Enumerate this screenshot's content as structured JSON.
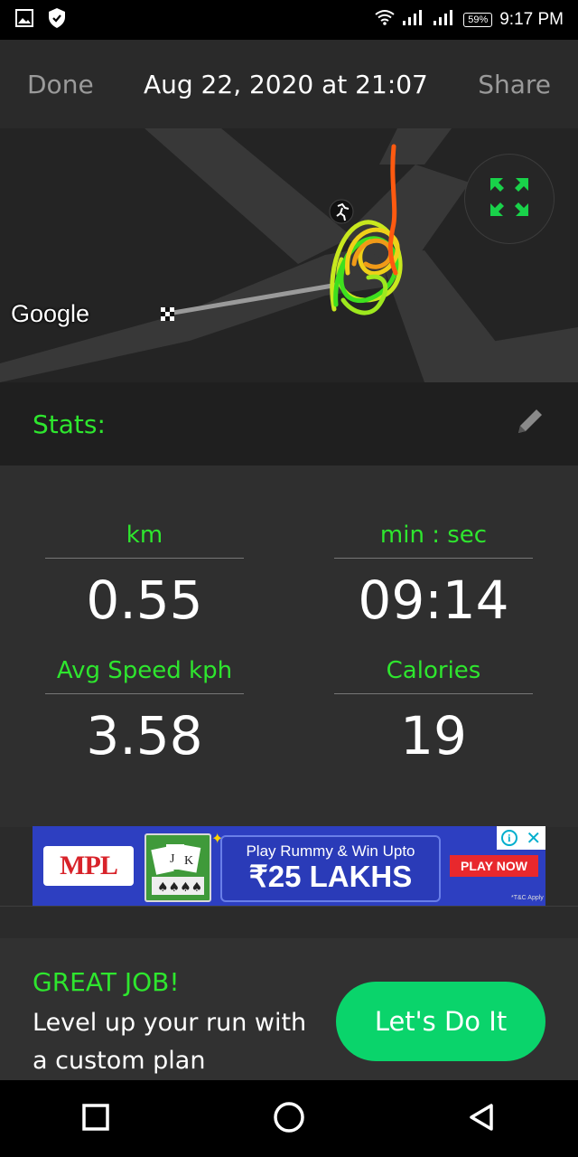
{
  "status_bar": {
    "battery": "59%",
    "time": "9:17 PM"
  },
  "header": {
    "done_label": "Done",
    "title": "Aug 22, 2020 at 21:07",
    "share_label": "Share"
  },
  "map": {
    "google_label": "Google"
  },
  "stats_header": {
    "label": "Stats:"
  },
  "stats": {
    "distance": {
      "label": "km",
      "value": "0.55"
    },
    "time": {
      "label": "min : sec",
      "value": "09:14"
    },
    "avg_speed": {
      "label": "Avg Speed kph",
      "value": "3.58"
    },
    "calories": {
      "label": "Calories",
      "value": "19"
    }
  },
  "ad": {
    "brand": "MPL",
    "line1": "Play Rummy & Win Upto",
    "line2": "₹25 LAKHS",
    "cta": "PLAY NOW",
    "tc": "*T&C Apply"
  },
  "promo": {
    "headline": "GREAT JOB!",
    "body_line1": "Level up your run with",
    "body_line2": "a custom plan",
    "button_label": "Let's Do It"
  }
}
